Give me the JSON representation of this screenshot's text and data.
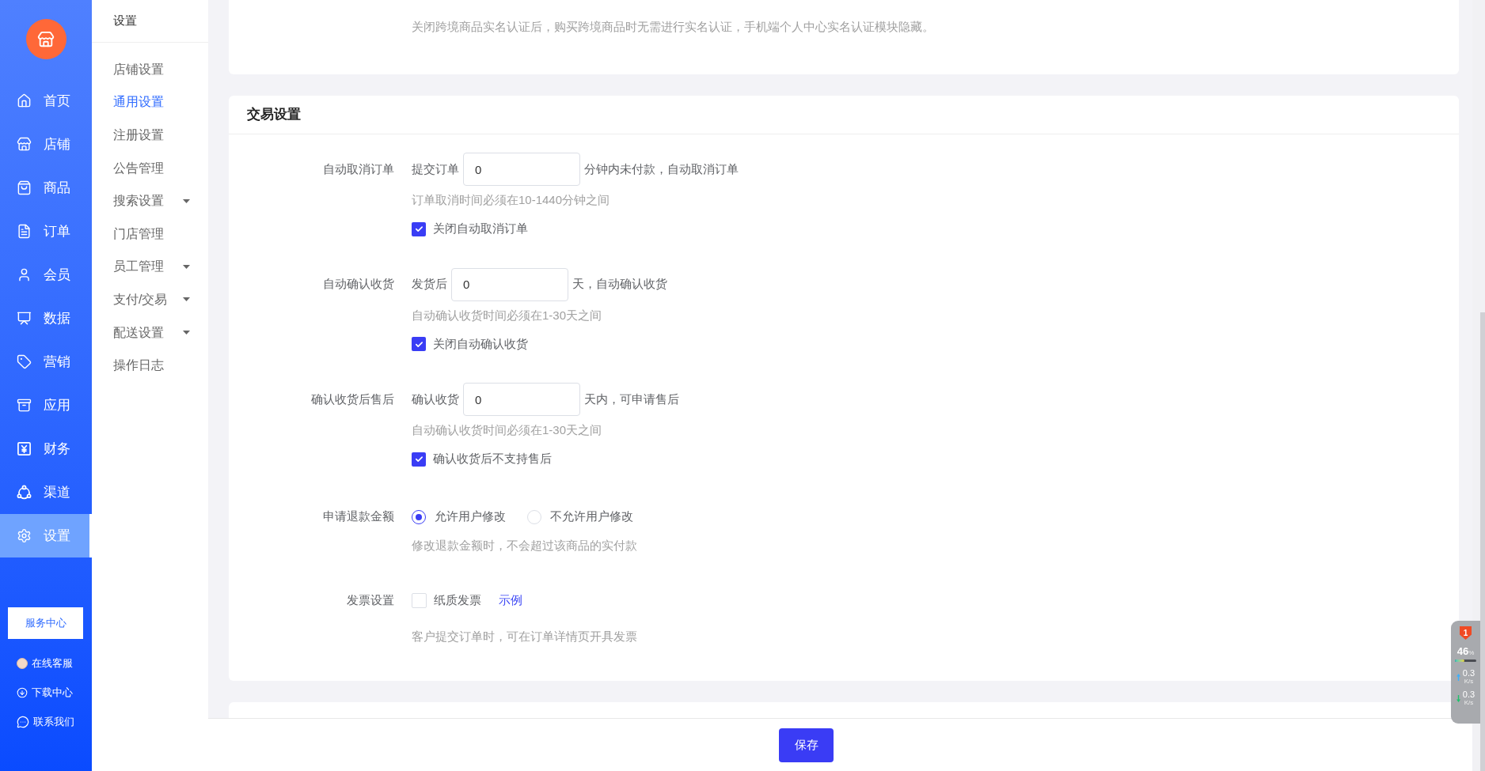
{
  "sidebar": {
    "items": [
      {
        "label": "首页",
        "selected": false
      },
      {
        "label": "店铺",
        "selected": false
      },
      {
        "label": "商品",
        "selected": false
      },
      {
        "label": "订单",
        "selected": false
      },
      {
        "label": "会员",
        "selected": false
      },
      {
        "label": "数据",
        "selected": false
      },
      {
        "label": "营销",
        "selected": false
      },
      {
        "label": "应用",
        "selected": false
      },
      {
        "label": "财务",
        "selected": false
      },
      {
        "label": "渠道",
        "selected": false
      },
      {
        "label": "设置",
        "selected": true
      }
    ],
    "service_button": "服务中心",
    "links": [
      "在线客服",
      "下载中心",
      "联系我们"
    ]
  },
  "submenu": {
    "title": "设置",
    "items": [
      {
        "label": "店铺设置",
        "kind": "link",
        "selected": false
      },
      {
        "label": "通用设置",
        "kind": "link",
        "selected": true
      },
      {
        "label": "注册设置",
        "kind": "link",
        "selected": false
      },
      {
        "label": "公告管理",
        "kind": "link",
        "selected": false
      },
      {
        "label": "搜索设置",
        "kind": "group",
        "selected": false
      },
      {
        "label": "门店管理",
        "kind": "link",
        "selected": false
      },
      {
        "label": "员工管理",
        "kind": "group",
        "selected": false
      },
      {
        "label": "支付/交易",
        "kind": "group",
        "selected": false
      },
      {
        "label": "配送设置",
        "kind": "group",
        "selected": false
      },
      {
        "label": "操作日志",
        "kind": "link",
        "selected": false
      }
    ]
  },
  "cross_border_card": {
    "hint": "关闭跨境商品实名认证后，购买跨境商品时无需进行实名认证，手机端个人中心实名认证模块隐藏。"
  },
  "trade_card": {
    "title": "交易设置",
    "rows": [
      {
        "kind": "input",
        "label": "自动取消订单",
        "prefix": "提交订单",
        "value": "0",
        "suffix": "分钟内未付款，自动取消订单",
        "hint": "订单取消时间必须在10-1440分钟之间",
        "checkbox": {
          "label": "关闭自动取消订单",
          "checked": true
        }
      },
      {
        "kind": "input",
        "label": "自动确认收货",
        "prefix": "发货后",
        "value": "0",
        "suffix": "天，自动确认收货",
        "hint": "自动确认收货时间必须在1-30天之间",
        "checkbox": {
          "label": "关闭自动确认收货",
          "checked": true
        }
      },
      {
        "kind": "input",
        "label": "确认收货后售后",
        "prefix": "确认收货",
        "value": "0",
        "suffix": "天内，可申请售后",
        "hint": "自动确认收货时间必须在1-30天之间",
        "checkbox": {
          "label": "确认收货后不支持售后",
          "checked": true
        }
      },
      {
        "kind": "radio",
        "label": "申请退款金额",
        "options": [
          {
            "label": "允许用户修改",
            "selected": true
          },
          {
            "label": "不允许用户修改",
            "selected": false
          }
        ],
        "hint": "修改退款金额时，不会超过该商品的实付款"
      },
      {
        "kind": "checkbox",
        "label": "发票设置",
        "checkbox": {
          "label": "纸质发票",
          "checked": false
        },
        "link": "示例",
        "hint": "客户提交订单时，可在订单详情页开具发票"
      }
    ]
  },
  "footer": {
    "save_button": "保存"
  },
  "system_monitor": {
    "alerts": "1",
    "memory": "46",
    "memory_unit": "%",
    "level": 0.46,
    "upload": "0.3",
    "upload_unit": "K/s",
    "download": "0.3",
    "download_unit": "K/s"
  }
}
